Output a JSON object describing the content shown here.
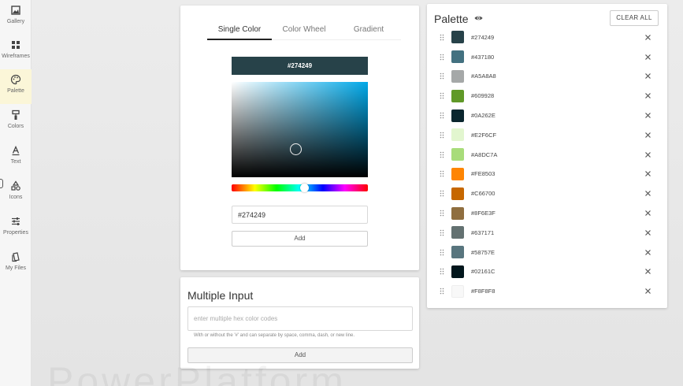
{
  "sidebar": {
    "items": [
      {
        "label": "Gallery",
        "icon": "image-icon"
      },
      {
        "label": "Wireframes",
        "icon": "grid-icon"
      },
      {
        "label": "Palette",
        "icon": "palette-icon",
        "active": true
      },
      {
        "label": "Colors",
        "icon": "paint-roller-icon"
      },
      {
        "label": "Text",
        "icon": "text-icon"
      },
      {
        "label": "Icons",
        "icon": "shapes-icon"
      },
      {
        "label": "Properties",
        "icon": "sliders-icon"
      },
      {
        "label": "My Files",
        "icon": "files-icon"
      }
    ]
  },
  "picker": {
    "tabs": [
      {
        "label": "Single Color",
        "active": true
      },
      {
        "label": "Color Wheel"
      },
      {
        "label": "Gradient"
      }
    ],
    "current_hex": "#274249",
    "input_value": "#274249",
    "add_label": "Add"
  },
  "multi": {
    "title": "Multiple Input",
    "placeholder": "enter multiple hex color codes",
    "help": "With or without the '#' and can separate by space, comma, dash, or new line.",
    "add_label": "Add"
  },
  "palette": {
    "title": "Palette",
    "clear_label": "CLEAR ALL",
    "colors": [
      "#274249",
      "#437180",
      "#A5A8A8",
      "#609928",
      "#0A262E",
      "#E2F6CF",
      "#A8DC7A",
      "#FE8503",
      "#C66700",
      "#8F6E3F",
      "#637171",
      "#58757E",
      "#02161C",
      "#F8F8F8"
    ]
  },
  "watermark": "PowerPlatform"
}
